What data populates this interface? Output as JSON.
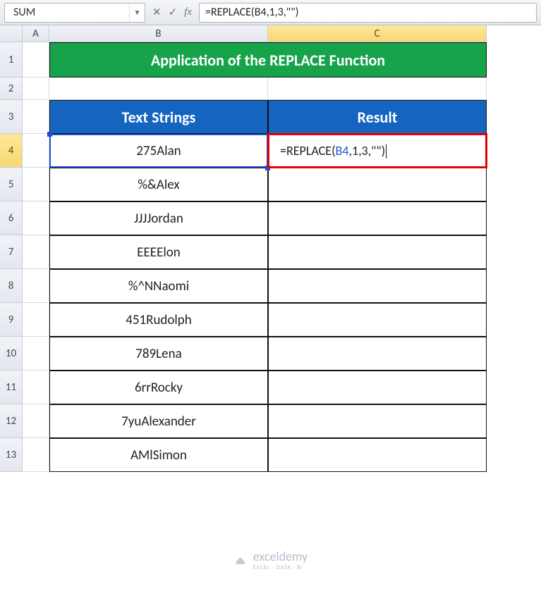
{
  "nameBox": "SUM",
  "formulaBar": "=REPLACE(B4,1,3,\"\")",
  "columns": [
    "A",
    "B",
    "C"
  ],
  "rows": [
    "1",
    "2",
    "3",
    "4",
    "5",
    "6",
    "7",
    "8",
    "9",
    "10",
    "11",
    "12",
    "13"
  ],
  "title": "Application of the REPLACE Function",
  "headers": {
    "b": "Text Strings",
    "c": "Result"
  },
  "data": {
    "b4": "275Alan",
    "b5": "%&Alex",
    "b6": "JJJJordan",
    "b7": "EEEElon",
    "b8": "%^NNaomi",
    "b9": "451Rudolph",
    "b10": "789Lena",
    "b11": "6rrRocky",
    "b12": "7yuAlexander",
    "b13": "AMlSimon"
  },
  "c4_formula_prefix": "=REPLACE(",
  "c4_formula_ref": "B4",
  "c4_formula_suffix": ",1,3,\"\")",
  "watermark": {
    "brand": "exceldemy",
    "tag": "EXCEL · DATA · BI"
  }
}
